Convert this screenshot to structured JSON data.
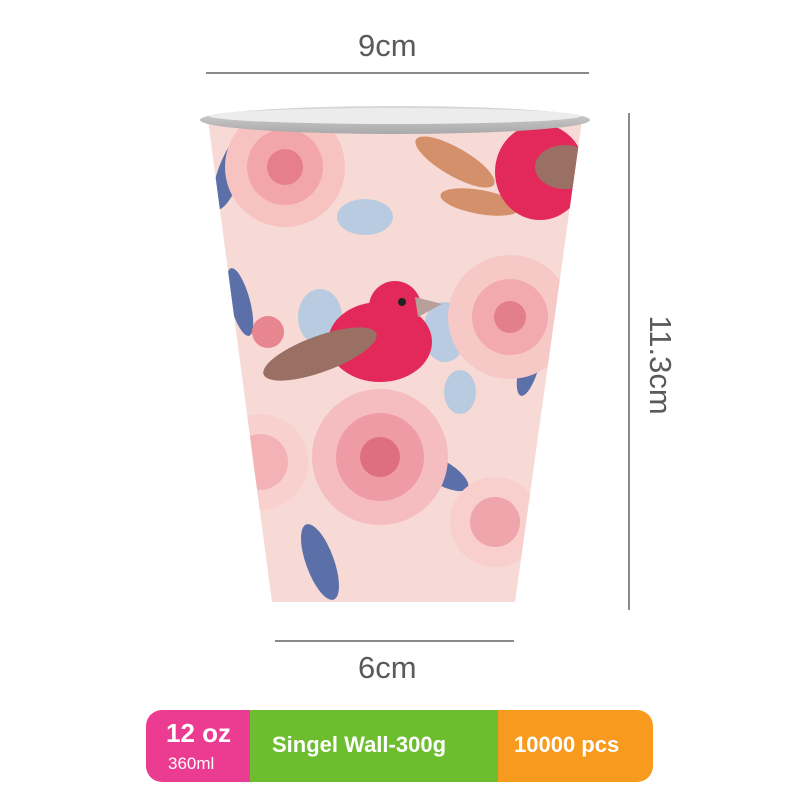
{
  "dimensions": {
    "top_width": "9cm",
    "bottom_width": "6cm",
    "height": "11.3cm"
  },
  "specs": {
    "size_oz": "12 oz",
    "size_ml": "360ml",
    "wall": "Singel Wall-300g",
    "quantity": "10000 pcs"
  },
  "colors": {
    "size_badge": "#ec3c92",
    "wall_badge": "#6cbe2e",
    "qty_badge": "#f79a1d",
    "cup_base": "#f7d9d6",
    "rose": "#f3a9b0",
    "bird": "#e3285a",
    "leaf_blue": "#5b6fa8"
  }
}
